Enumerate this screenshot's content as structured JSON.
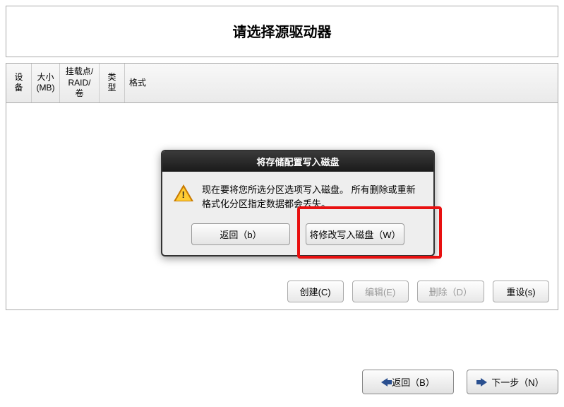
{
  "header": {
    "title": "请选择源驱动器"
  },
  "table": {
    "columns": {
      "device": "设备",
      "size": "大小\n(MB)",
      "mount": "挂载点/\nRAID/卷",
      "type": "类型",
      "format": "格式"
    }
  },
  "actions": {
    "create": "创建(C)",
    "edit": "编辑(E)",
    "delete": "删除（D）",
    "reset": "重设(s)"
  },
  "dialog": {
    "title": "将存储配置写入磁盘",
    "message": "现在要将您所选分区选项写入磁盘。 所有删除或重新格式化分区指定数据都会丢失。",
    "back": "返回（b）",
    "write": "将修改写入磁盘（W）"
  },
  "nav": {
    "back": "返回（B）",
    "next": "下一步（N）"
  }
}
